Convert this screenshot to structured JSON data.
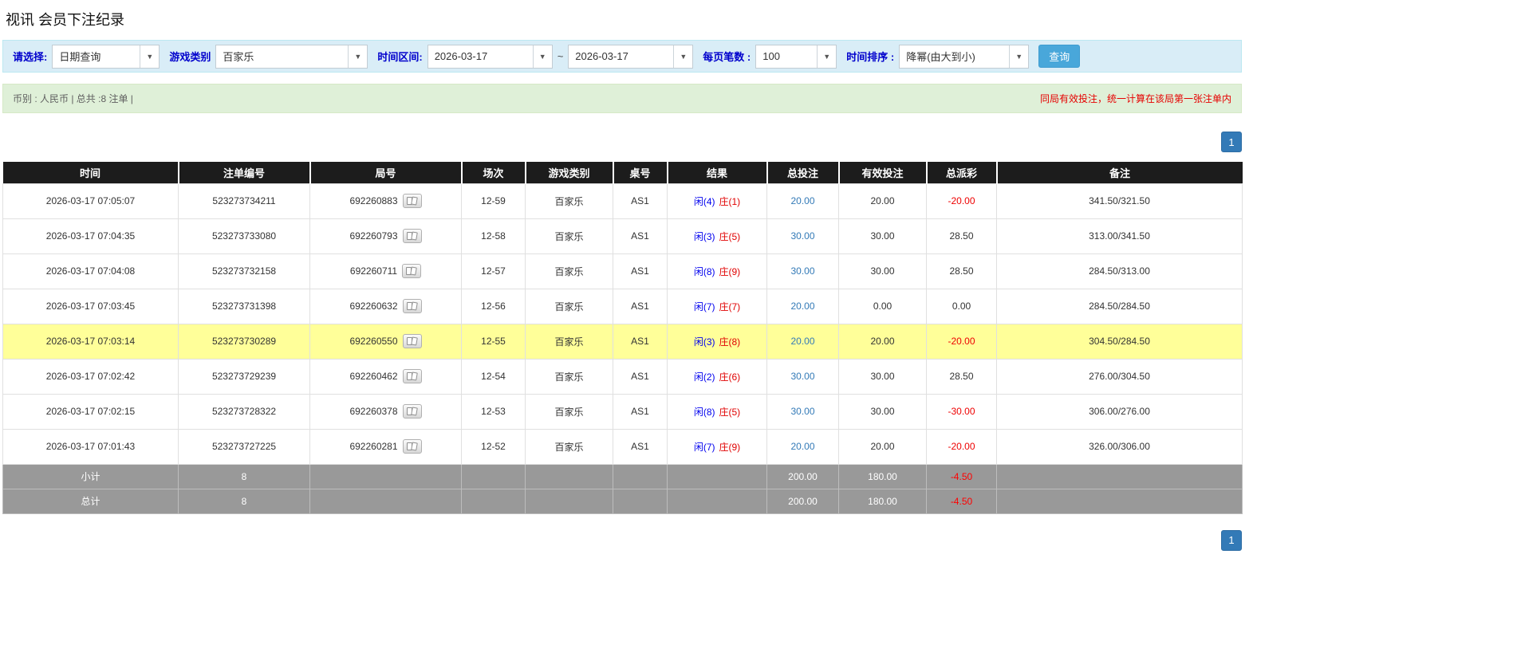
{
  "page": {
    "title": "视讯 会员下注纪录"
  },
  "icons": {
    "dropdown_arrow": "▼"
  },
  "colors": {
    "accent_blue": "#337ab7",
    "filter_bar_bg": "#d9edf7",
    "summary_bar_bg": "#dff0d8",
    "header_bg": "#1c1c1c",
    "highlight_yellow": "#ffff99",
    "player_blue": "#0000ee",
    "banker_red": "#e00000",
    "negative_red": "#ee0000",
    "summary_gray": "#999999"
  },
  "filter": {
    "query_type_label": "请选择:",
    "query_type_value": "日期查询",
    "game_type_label": "游戏类别",
    "game_type_value": "百家乐",
    "date_range_label": "时间区间:",
    "date_from": "2026-03-17",
    "date_separator": "~",
    "date_to": "2026-03-17",
    "page_size_label": "每页笔数 :",
    "page_size_value": "100",
    "sort_label": "时间排序 :",
    "sort_value": "降幂(由大到小)",
    "search_button_label": "查询"
  },
  "summary": {
    "info_text": "币别 : 人民币 | 总共 :8 注单 |",
    "notice_text": "同局有效投注，统一计算在该局第一张注单内"
  },
  "pagination": {
    "current_page": "1"
  },
  "table": {
    "headers": [
      "时间",
      "注单编号",
      "局号",
      "场次",
      "游戏类别",
      "桌号",
      "结果",
      "总投注",
      "有效投注",
      "总派彩",
      "备注"
    ],
    "rows": [
      {
        "time": "2026-03-17 07:05:07",
        "bet_id": "523273734211",
        "round": "692260883",
        "session": "12-59",
        "game": "百家乐",
        "table": "AS1",
        "player": "闲(4)",
        "banker": "庄(1)",
        "total_bet": "20.00",
        "valid_bet": "20.00",
        "payout": "-20.00",
        "note": "341.50/321.50",
        "highlight": false
      },
      {
        "time": "2026-03-17 07:04:35",
        "bet_id": "523273733080",
        "round": "692260793",
        "session": "12-58",
        "game": "百家乐",
        "table": "AS1",
        "player": "闲(3)",
        "banker": "庄(5)",
        "total_bet": "30.00",
        "valid_bet": "30.00",
        "payout": "28.50",
        "note": "313.00/341.50",
        "highlight": false
      },
      {
        "time": "2026-03-17 07:04:08",
        "bet_id": "523273732158",
        "round": "692260711",
        "session": "12-57",
        "game": "百家乐",
        "table": "AS1",
        "player": "闲(8)",
        "banker": "庄(9)",
        "total_bet": "30.00",
        "valid_bet": "30.00",
        "payout": "28.50",
        "note": "284.50/313.00",
        "highlight": false
      },
      {
        "time": "2026-03-17 07:03:45",
        "bet_id": "523273731398",
        "round": "692260632",
        "session": "12-56",
        "game": "百家乐",
        "table": "AS1",
        "player": "闲(7)",
        "banker": "庄(7)",
        "total_bet": "20.00",
        "valid_bet": "0.00",
        "payout": "0.00",
        "note": "284.50/284.50",
        "highlight": false
      },
      {
        "time": "2026-03-17 07:03:14",
        "bet_id": "523273730289",
        "round": "692260550",
        "session": "12-55",
        "game": "百家乐",
        "table": "AS1",
        "player": "闲(3)",
        "banker": "庄(8)",
        "total_bet": "20.00",
        "valid_bet": "20.00",
        "payout": "-20.00",
        "note": "304.50/284.50",
        "highlight": true
      },
      {
        "time": "2026-03-17 07:02:42",
        "bet_id": "523273729239",
        "round": "692260462",
        "session": "12-54",
        "game": "百家乐",
        "table": "AS1",
        "player": "闲(2)",
        "banker": "庄(6)",
        "total_bet": "30.00",
        "valid_bet": "30.00",
        "payout": "28.50",
        "note": "276.00/304.50",
        "highlight": false
      },
      {
        "time": "2026-03-17 07:02:15",
        "bet_id": "523273728322",
        "round": "692260378",
        "session": "12-53",
        "game": "百家乐",
        "table": "AS1",
        "player": "闲(8)",
        "banker": "庄(5)",
        "total_bet": "30.00",
        "valid_bet": "30.00",
        "payout": "-30.00",
        "note": "306.00/276.00",
        "highlight": false
      },
      {
        "time": "2026-03-17 07:01:43",
        "bet_id": "523273727225",
        "round": "692260281",
        "session": "12-52",
        "game": "百家乐",
        "table": "AS1",
        "player": "闲(7)",
        "banker": "庄(9)",
        "total_bet": "20.00",
        "valid_bet": "20.00",
        "payout": "-20.00",
        "note": "326.00/306.00",
        "highlight": false
      }
    ],
    "subtotal": {
      "label": "小计",
      "count": "8",
      "total_bet": "200.00",
      "valid_bet": "180.00",
      "payout": "-4.50"
    },
    "grand_total": {
      "label": "总计",
      "count": "8",
      "total_bet": "200.00",
      "valid_bet": "180.00",
      "payout": "-4.50"
    }
  }
}
